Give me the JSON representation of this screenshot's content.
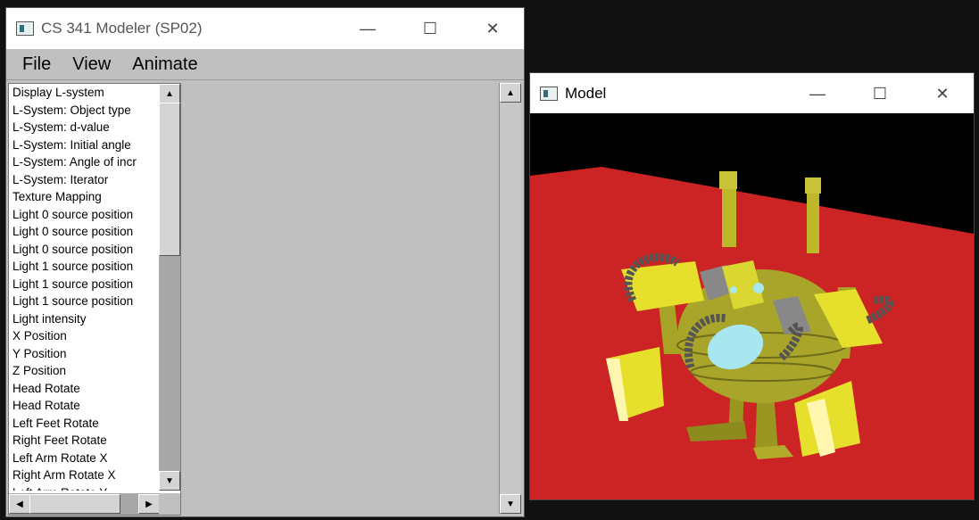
{
  "modeler_window": {
    "title": "CS 341 Modeler (SP02)",
    "controls": {
      "minimize": "—",
      "maximize": "☐",
      "close": "✕"
    },
    "menu": [
      "File",
      "View",
      "Animate"
    ],
    "controls_list": [
      "Display L-system",
      "L-System: Object type",
      "L-System: d-value",
      "L-System: Initial angle",
      "L-System: Angle of incr",
      "L-System: Iterator",
      "Texture Mapping",
      "Light 0 source position",
      "Light 0 source position",
      "Light 0 source position",
      "Light 1 source position",
      "Light 1 source position",
      "Light 1 source position",
      "Light intensity",
      "X Position",
      "Y Position",
      "Z Position",
      "Head Rotate",
      "Head Rotate",
      "Left Feet Rotate",
      "Right Feet Rotate",
      "Left Arm Rotate X",
      "Right Arm Rotate X",
      "Left Arm Rotate Y"
    ]
  },
  "model_window": {
    "title": "Model",
    "controls": {
      "minimize": "—",
      "maximize": "☐",
      "close": "✕"
    }
  },
  "colors": {
    "floor": "#cc2424",
    "robot_body": "#a8a428",
    "robot_yellow": "#e6e02c",
    "robot_dark": "#6a6a6a",
    "eye": "#a8e6f0"
  }
}
